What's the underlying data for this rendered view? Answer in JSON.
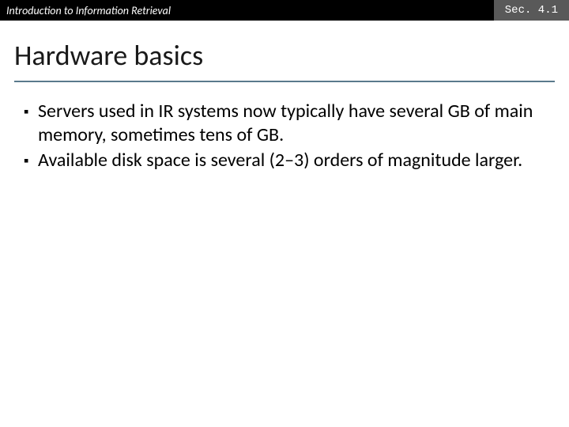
{
  "header": {
    "course": "Introduction to Information Retrieval",
    "section": "Sec. 4.1"
  },
  "title": "Hardware basics",
  "bullets": [
    "Servers used in IR systems now typically have several GB of main memory, sometimes tens of GB.",
    "Available disk space is several (2–3) orders of magnitude larger."
  ]
}
